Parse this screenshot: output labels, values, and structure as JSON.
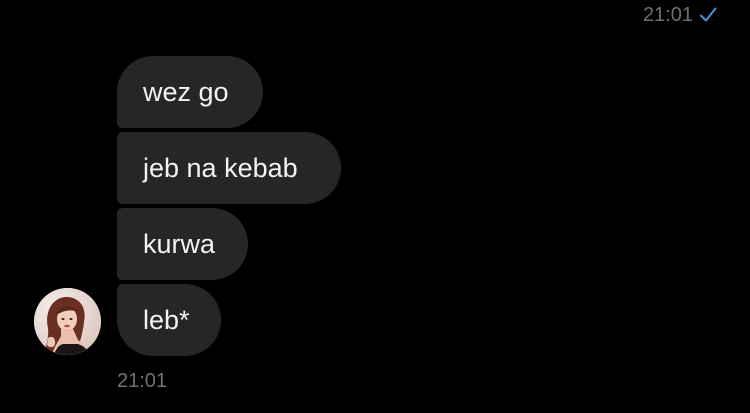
{
  "header": {
    "sent_time": "21:01",
    "read_status_icon": "check-icon",
    "accent_color": "#4a90d9"
  },
  "conversation": {
    "messages": [
      {
        "text": "wez go"
      },
      {
        "text": "jeb na kebab"
      },
      {
        "text": "kurwa"
      },
      {
        "text": "leb*"
      }
    ],
    "received_time": "21:01",
    "sender_avatar_icon": "avatar",
    "bubble_color": "#262628",
    "text_color": "#f2f2f2"
  }
}
